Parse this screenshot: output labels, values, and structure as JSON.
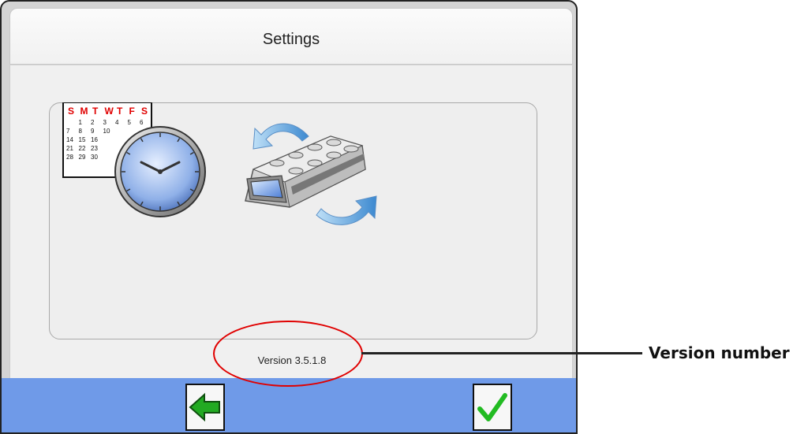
{
  "window": {
    "title": "Settings"
  },
  "calendar": {
    "header": [
      "S",
      "M",
      "T",
      "W",
      "T",
      "F",
      "S"
    ],
    "rows": [
      [
        "",
        "1",
        "2",
        "3",
        "4",
        "5",
        "6"
      ],
      [
        "7",
        "8",
        "9",
        "10",
        "",
        "",
        ""
      ],
      [
        "14",
        "15",
        "16",
        "",
        "",
        "",
        ""
      ],
      [
        "21",
        "22",
        "23",
        "",
        "",
        "",
        ""
      ],
      [
        "28",
        "29",
        "30",
        "",
        "",
        "",
        ""
      ]
    ]
  },
  "version": {
    "text": "Version 3.5.1.8"
  },
  "annotation": {
    "label": "Version number",
    "color": "#e00000"
  },
  "colors": {
    "footer": "#6f9ae8",
    "back_arrow": "#22aa22",
    "check": "#22bb22",
    "header_days": "#e00000"
  },
  "icons": {
    "date_time": "calendar-clock-icon",
    "instrument": "device-sync-icon",
    "back": "back-arrow-icon",
    "confirm": "checkmark-icon"
  }
}
